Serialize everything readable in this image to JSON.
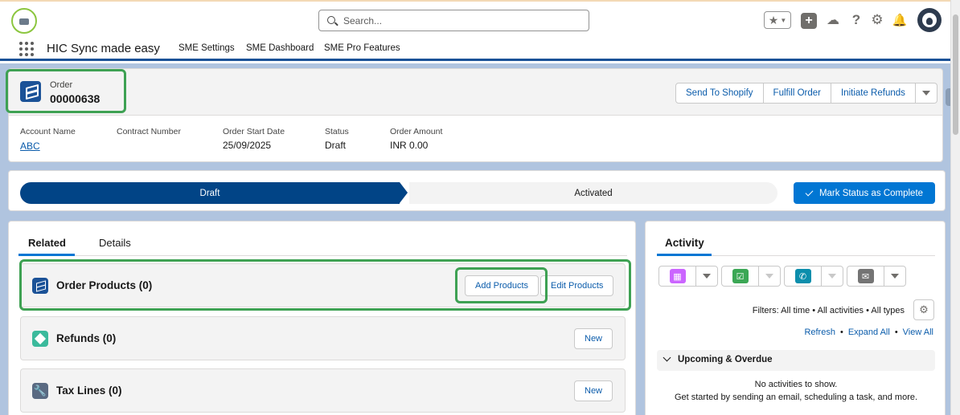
{
  "search": {
    "placeholder": "Search..."
  },
  "app": {
    "name": "HIC Sync made easy"
  },
  "nav": {
    "items": [
      "SME Settings",
      "SME Dashboard",
      "SME Pro Features"
    ]
  },
  "record": {
    "type_label": "Order",
    "number": "00000638",
    "actions": [
      "Send To Shopify",
      "Fulfill Order",
      "Initiate Refunds"
    ],
    "fields": [
      {
        "label": "Account Name",
        "value": "ABC",
        "link": true
      },
      {
        "label": "Contract Number",
        "value": ""
      },
      {
        "label": "Order Start Date",
        "value": "25/09/2025"
      },
      {
        "label": "Status",
        "value": "Draft"
      },
      {
        "label": "Order Amount",
        "value": "INR 0.00"
      }
    ]
  },
  "path": {
    "current": "Draft",
    "next": "Activated",
    "mark_button": "Mark Status as Complete"
  },
  "tabs": {
    "related": "Related",
    "details": "Details"
  },
  "related_lists": [
    {
      "title": "Order Products (0)",
      "buttons": [
        "Add Products",
        "Edit Products"
      ],
      "icon": "order-icon"
    },
    {
      "title": "Refunds (0)",
      "buttons": [
        "New"
      ],
      "icon": "refund-icon"
    },
    {
      "title": "Tax Lines (0)",
      "buttons": [
        "New"
      ],
      "icon": "wrench-icon"
    }
  ],
  "activity": {
    "title": "Activity",
    "filters": "Filters: All time • All activities • All types",
    "links": [
      "Refresh",
      "Expand All",
      "View All"
    ],
    "upcoming": "Upcoming & Overdue",
    "empty_title": "No activities to show.",
    "empty_sub": "Get started by sending an email, scheduling a task, and more.",
    "publisher_colors": [
      "#cb65ff",
      "#3ba755",
      "#0c8eac",
      "#747474"
    ]
  },
  "colors": {
    "brand": "#014486",
    "accent": "#0176d3",
    "highlight": "#3ea153"
  }
}
